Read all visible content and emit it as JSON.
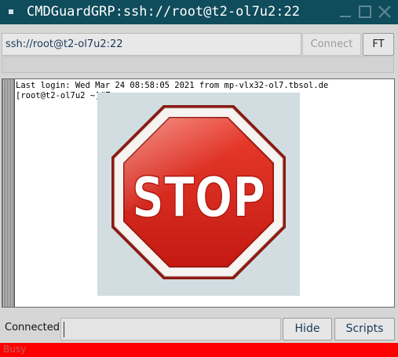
{
  "window": {
    "title": "CMDGuardGRP:ssh://root@t2-ol7u2:22",
    "icons": [
      "app-icon",
      "minimize-icon",
      "maximize-icon",
      "close-icon"
    ]
  },
  "hostbar": {
    "host_value": "ssh://root@t2-ol7u2:22",
    "connect_label": "Connect",
    "ft_label": "FT"
  },
  "terminal": {
    "line1": "Last login: Wed Mar 24 08:58:05 2021 from mp-vlx32-ol7.tbsol.de",
    "line2": "[root@t2-ol7u2 ~]#",
    "overlay_text": "STOP",
    "overlay_icon": "stop-sign-icon"
  },
  "bottombar": {
    "status": "Connected",
    "command_value": "",
    "hide_label": "Hide",
    "scripts_label": "Scripts"
  },
  "busy": {
    "label": "Busy",
    "color": "#ff0000"
  },
  "colors": {
    "titlebar": "#0f4c5c",
    "stop_red": "#d7261e"
  }
}
